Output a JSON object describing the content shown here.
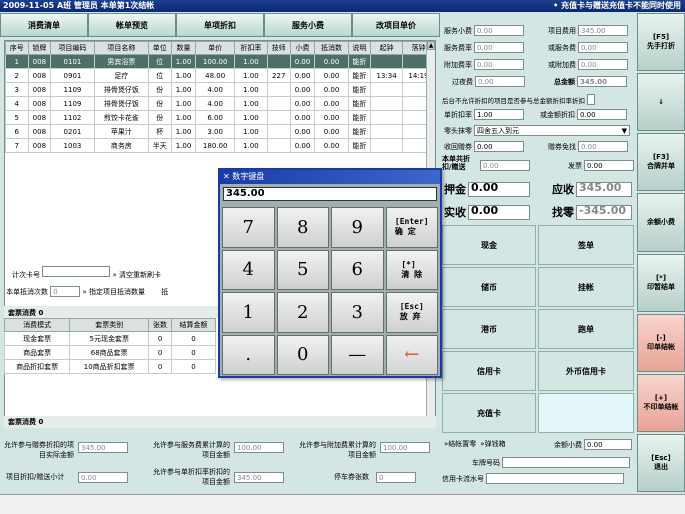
{
  "title": {
    "left": "2009-11-05 A班 管理员 本单第1次结帐",
    "right": "• 充值卡与赠送充值卡不能同时使用"
  },
  "topButtons": [
    "消费清单",
    "帐单预览",
    "单项折扣",
    "服务小费",
    "改项目单价"
  ],
  "grid": {
    "headers": [
      "序号",
      "锁牌",
      "项目编码",
      "项目名称",
      "单位",
      "数量",
      "单价",
      "折扣率",
      "技师",
      "小费",
      "抵消数",
      "说明",
      "起钟",
      "落钟"
    ],
    "rows": [
      [
        "1",
        "008",
        "0101",
        "男宾浴票",
        "位",
        "1.00",
        "100.00",
        "1.00",
        "",
        "0.00",
        "0.00",
        "能折",
        "",
        ""
      ],
      [
        "2",
        "008",
        "0901",
        "足疗",
        "位",
        "1.00",
        "48.00",
        "1.00",
        "227",
        "0.00",
        "0.00",
        "能折",
        "13:34",
        "14:19"
      ],
      [
        "3",
        "008",
        "1109",
        "排骨煲仔饭",
        "份",
        "1.00",
        "4.00",
        "1.00",
        "",
        "0.00",
        "0.00",
        "能折",
        "",
        ""
      ],
      [
        "4",
        "008",
        "1109",
        "排骨煲仔饭",
        "份",
        "1.00",
        "4.00",
        "1.00",
        "",
        "0.00",
        "0.00",
        "能折",
        "",
        ""
      ],
      [
        "5",
        "008",
        "1102",
        "煎饺卡花雀",
        "份",
        "1.00",
        "6.00",
        "1.00",
        "",
        "0.00",
        "0.00",
        "能折",
        "",
        ""
      ],
      [
        "6",
        "008",
        "0201",
        "苹果汁",
        "杯",
        "1.00",
        "3.00",
        "1.00",
        "",
        "0.00",
        "0.00",
        "能折",
        "",
        ""
      ],
      [
        "7",
        "008",
        "1003",
        "商务房",
        "半天",
        "1.00",
        "180.00",
        "1.00",
        "",
        "0.00",
        "0.00",
        "能折",
        "",
        ""
      ]
    ]
  },
  "mid": {
    "timecard": "计次卡号",
    "clear": "清空重新刷卡",
    "offset": "本单抵消次数",
    "offset_value": "0",
    "designate": "指定项目抵消数量",
    "deduct": "抵"
  },
  "coupon": {
    "title": "套票消费",
    "count": "0",
    "headers": [
      "消费模式",
      "套票类别",
      "张数",
      "结算金额"
    ],
    "rows": [
      [
        "现金套票",
        "5元现金套票",
        "0",
        "0"
      ],
      [
        "商品套票",
        "68商品套票",
        "0",
        "0"
      ],
      [
        "商品折扣套票",
        "10商品折扣套票",
        "0",
        "0"
      ]
    ],
    "footer": "套票消费",
    "footer_count": "0"
  },
  "bottom": {
    "l1": "允许参与赠券折扣的项目实际金额",
    "v1": "345.00",
    "l2": "允许参与服务费累计算的项目金额",
    "v2": "100.00",
    "l3": "允许参与附加费累计算的项目金额",
    "v3": "100.00",
    "l4": "项目折扣/赠送小计",
    "v4": "0.00",
    "l5": "允许参与单折扣率折扣的项目金额",
    "v5": "345.00",
    "l6": "停车券张数",
    "v6": "0"
  },
  "right": {
    "svc_fee": "服务小费",
    "svc_fee_v": "0.00",
    "item_total": "项目费用",
    "item_total_v": "345.00",
    "svc_rate": "服务费率",
    "svc_rate_v": "0.00",
    "or_svc": "或服务费",
    "or_svc_v": "0.00",
    "add_rate": "附加费率",
    "add_rate_v": "0.00",
    "or_add": "或附加费",
    "or_add_v": "0.00",
    "room": "过夜费",
    "room_v": "0.00",
    "total": "总金额",
    "total_v": "345.00",
    "note": "后台不允许折扣的项目是否参与总金额折扣率折扣",
    "disc": "单折扣率",
    "disc_v": "1.00",
    "or_disc": "或金额折扣",
    "or_disc_v": "0.00",
    "round": "零头抹零",
    "round_v": "四舍五入到元",
    "receipt": "收回赠券",
    "receipt_v": "0.00",
    "free": "赠券免找",
    "free_v": "0.00",
    "share": "本单共折扣/赠送",
    "share_v": "0.00",
    "invoice": "发票",
    "invoice_v": "0.00",
    "deposit": "押金",
    "deposit_v": "0.00",
    "due": "应收",
    "due_v": "345.00",
    "paid": "实收",
    "paid_v": "0.00",
    "change": "找零",
    "change_v": "-345.00",
    "pay": [
      "现金",
      "签单",
      "储币",
      "挂帐",
      "港币",
      "跑单",
      "信用卡",
      "外币信用卡",
      "充值卡"
    ],
    "b1": "结帐置零",
    "b2": "弹钱箱",
    "tip": "余额小费",
    "tip_v": "0.00",
    "carno": "车牌号码",
    "ccno": "信用卡流水号"
  },
  "side": [
    "[F5]\n先手打折",
    "↓",
    "[F3]\n合牌并单",
    "余额小费",
    "[*]\n印暂结单",
    "[-]\n印单结帐",
    "[+]\n不印单结帐",
    "[Esc]\n退出"
  ],
  "keypad": {
    "title": "数字键盘",
    "display": "345.00",
    "keys": [
      "7",
      "8",
      "9",
      "[Enter]\n确 定",
      "4",
      "5",
      "6",
      "[*]\n清 除",
      "1",
      "2",
      "3",
      "[Esc]\n放 弃",
      ".",
      "0",
      "—",
      "←"
    ]
  }
}
